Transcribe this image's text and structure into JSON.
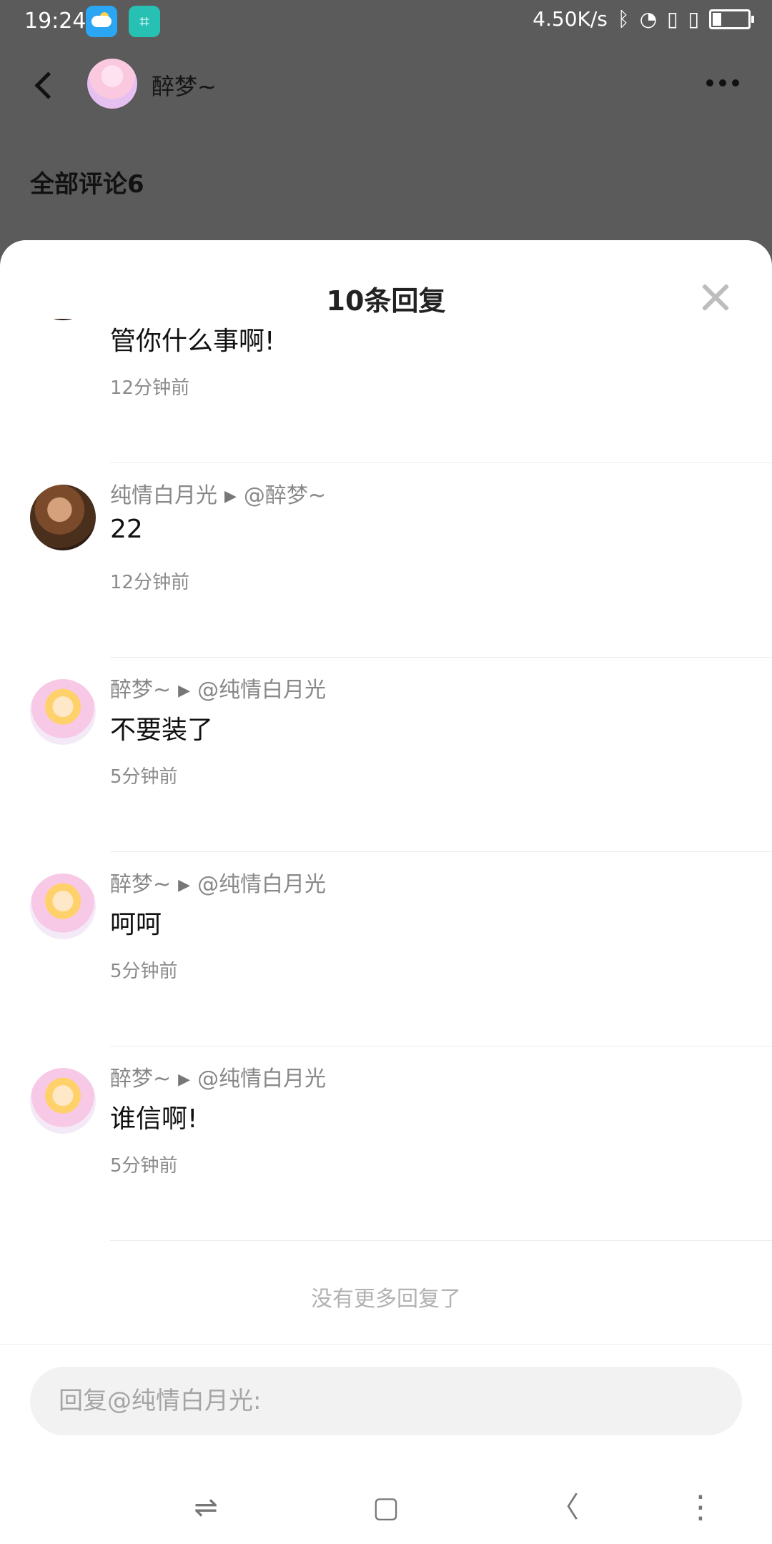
{
  "status_bar": {
    "time": "19:24",
    "net_speed": "4.50K/s",
    "icons": [
      "bluetooth-icon",
      "wifi-icon",
      "sim-icon",
      "sim-icon",
      "battery-icon"
    ]
  },
  "header": {
    "user_name": "醉梦~",
    "section_title": "全部评论6"
  },
  "sheet": {
    "title": "10条回复",
    "replies": [
      {
        "text": "管你什么事啊!",
        "time": "12分钟前"
      },
      {
        "author": "纯情白月光",
        "target": "@醉梦~",
        "text": "22",
        "time": "12分钟前",
        "avatar": "brown"
      },
      {
        "author": "醉梦~",
        "target": "@纯情白月光",
        "text": "不要装了",
        "time": "5分钟前",
        "avatar": "pink"
      },
      {
        "author": "醉梦~",
        "target": "@纯情白月光",
        "text": "呵呵",
        "time": "5分钟前",
        "avatar": "pink"
      },
      {
        "author": "醉梦~",
        "target": "@纯情白月光",
        "text": "谁信啊!",
        "time": "5分钟前",
        "avatar": "pink"
      }
    ],
    "no_more": "没有更多回复了",
    "input_placeholder": "回复@纯情白月光:"
  },
  "navbar": {
    "icons": [
      "switch-apps-icon",
      "home-icon",
      "back-icon",
      "menu-icon"
    ]
  }
}
